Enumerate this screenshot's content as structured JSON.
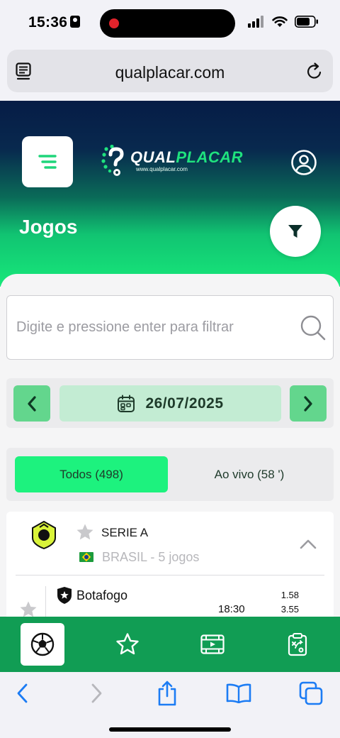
{
  "status_bar": {
    "time": "15:36",
    "signal_icon": "signal-bars-icon",
    "wifi_icon": "wifi-icon",
    "battery_icon": "battery-icon"
  },
  "browser": {
    "url": "qualplacar.com",
    "reader_icon": "reader-mode-icon",
    "reload_icon": "reload-icon",
    "toolbar": [
      "back-arrow-icon",
      "forward-arrow-icon",
      "share-icon",
      "bookmarks-icon",
      "tabs-icon"
    ]
  },
  "site": {
    "logo_part1": "QUAL",
    "logo_part2": "PLACAR",
    "logo_url": "www.qualplacar.com",
    "page_title": "Jogos",
    "colors": {
      "header_dark": "#061c46",
      "accent_green": "#1df27e",
      "nav_green": "#119d54"
    }
  },
  "search": {
    "placeholder": "Digite e pressione enter para filtrar",
    "value": ""
  },
  "date_nav": {
    "date": "26/07/2025"
  },
  "tabs": {
    "all_label": "Todos (498)",
    "live_label": "Ao vivo (58 ')"
  },
  "league": {
    "name": "SERIE A",
    "country_summary": "BRASIL - 5 jogos",
    "expanded": true,
    "matches": [
      {
        "home_team": "Botafogo",
        "time": "18:30",
        "odds": [
          "1.58",
          "3.55"
        ]
      }
    ]
  },
  "bottom_nav": {
    "items": [
      "soccer-ball-icon",
      "star-icon",
      "video-icon",
      "clipboard-tactics-icon"
    ],
    "active_index": 0
  }
}
